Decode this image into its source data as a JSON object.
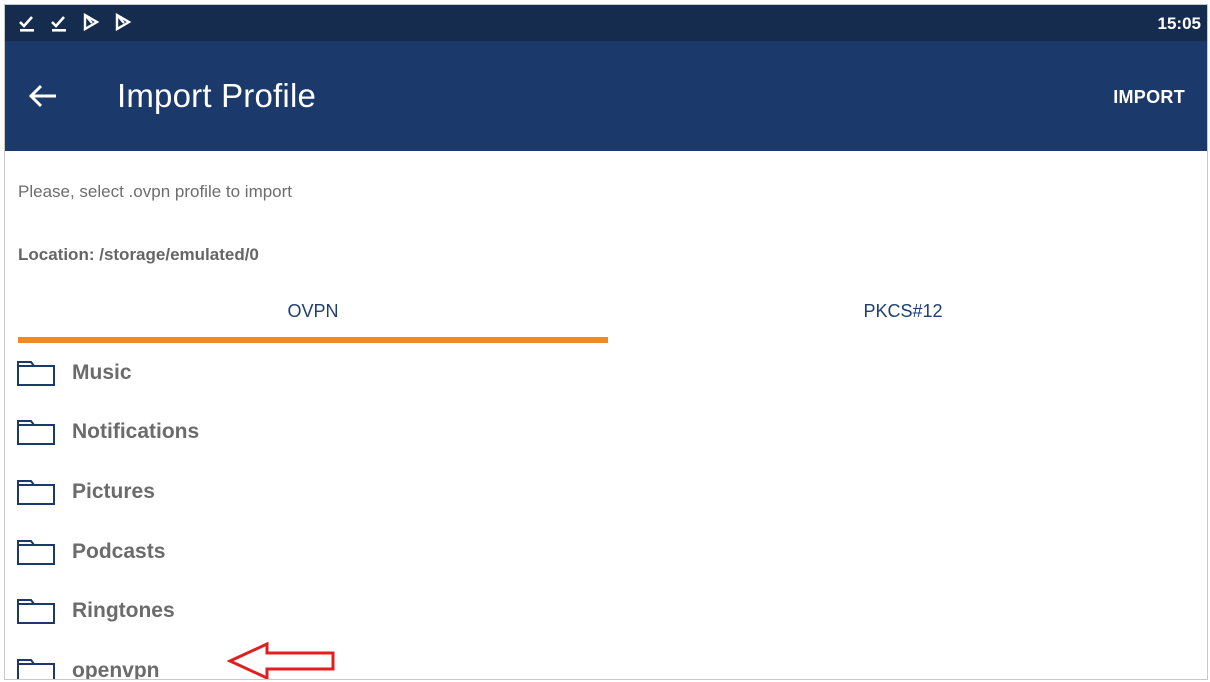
{
  "status_bar": {
    "time": "15:05",
    "icons": [
      "download-done-icon",
      "download-done-icon",
      "play-store-icon",
      "play-store-icon"
    ]
  },
  "app_bar": {
    "back_icon": "arrow-back-icon",
    "title": "Import Profile",
    "import_label": "IMPORT"
  },
  "instruction": "Please, select .ovpn profile to import",
  "location": "Location: /storage/emulated/0",
  "tabs": [
    {
      "label": "OVPN",
      "selected": true
    },
    {
      "label": "PKCS#12",
      "selected": false
    }
  ],
  "files": [
    {
      "name": "Music",
      "icon": "folder-icon"
    },
    {
      "name": "Notifications",
      "icon": "folder-icon"
    },
    {
      "name": "Pictures",
      "icon": "folder-icon"
    },
    {
      "name": "Podcasts",
      "icon": "folder-icon"
    },
    {
      "name": "Ringtones",
      "icon": "folder-icon"
    },
    {
      "name": "openvpn",
      "icon": "folder-icon"
    }
  ],
  "colors": {
    "status_bar": "#152c4f",
    "app_bar": "#1b3a6b",
    "tab_indicator": "#f28a24",
    "annotation_arrow": "#e02020"
  }
}
